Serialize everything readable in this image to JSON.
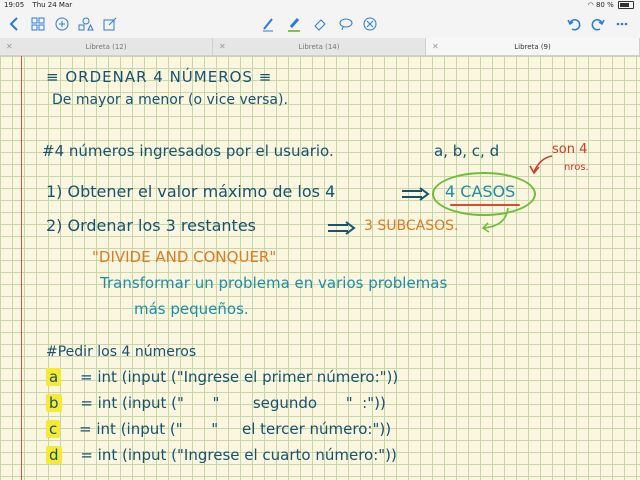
{
  "status": {
    "time": "19:05",
    "date": "Thu 24 Mar",
    "battery": "80 %"
  },
  "toolbar": {
    "left_icons": [
      "back-icon",
      "grid-icon",
      "add-icon",
      "shapes-icon",
      "edit-icon"
    ],
    "mid_icons": [
      "pen-icon",
      "highlighter-icon",
      "eraser-icon",
      "lasso-icon",
      "delete-icon"
    ],
    "right_icons": [
      "undo-icon",
      "redo-icon",
      "more-icon"
    ]
  },
  "tabs": [
    {
      "label": "Libreta (12)",
      "active": false
    },
    {
      "label": "Libreta (14)",
      "active": false
    },
    {
      "label": "Libreta (9)",
      "active": true
    }
  ],
  "note": {
    "title": "≡ ORDENAR 4 NÚMEROS ≡",
    "subtitle": "De mayor a menor (o vice versa).",
    "line1": "#4 números ingresados por el usuario.",
    "vars": "a, b, c, d",
    "annotation_son": "son 4",
    "annotation_nros": "nros.",
    "step1": "1) Obtener el valor máximo de los 4",
    "casos": "4 CASOS",
    "step2": "2) Ordenar los 3 restantes",
    "subcasos": "3 SUBCASOS.",
    "divide": "\"DIVIDE AND CONQUER\"",
    "transformar1": "Transformar un problema en varios problemas",
    "transformar2": "más pequeños.",
    "code_comment": "#Pedir los 4 números",
    "code": [
      {
        "var": "a",
        "rest": "= int (input (\"Ingrese el primer número:\"))"
      },
      {
        "var": "b",
        "rest": "= int (input (\"      \"       segundo      \"  :\"))"
      },
      {
        "var": "c",
        "rest": "= int (input (\"      \"     el tercer número:\"))"
      },
      {
        "var": "d",
        "rest": "= int (input (\"Ingrese el cuarto número:\"))"
      }
    ]
  }
}
